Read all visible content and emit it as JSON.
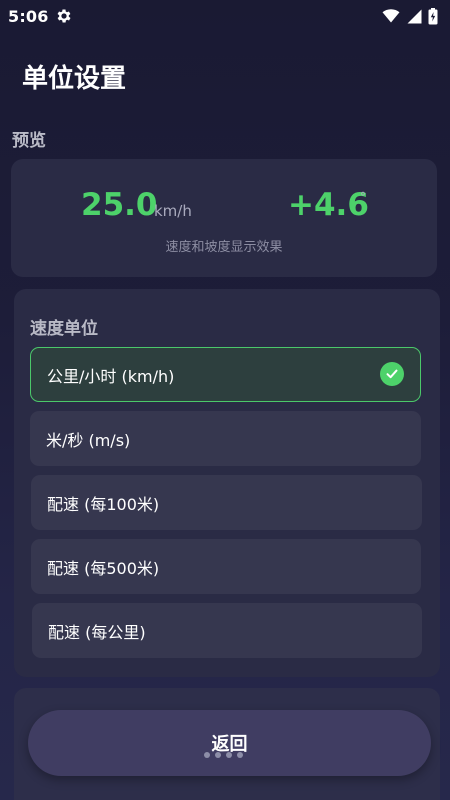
{
  "status_bar": {
    "time": "5:06"
  },
  "page": {
    "title": "单位设置"
  },
  "preview": {
    "label": "预览",
    "speed_value": "25.0",
    "speed_unit": "km/h",
    "slope_value": "+4.6",
    "slope_unit": "°",
    "caption": "速度和坡度显示效果"
  },
  "speed_units": {
    "title": "速度单位",
    "options": [
      {
        "label": "公里/小时 (km/h)",
        "selected": true
      },
      {
        "label": "米/秒 (m/s)",
        "selected": false
      },
      {
        "label": "配速 (每100米)",
        "selected": false
      },
      {
        "label": "配速 (每500米)",
        "selected": false
      },
      {
        "label": "配速 (每公里)",
        "selected": false
      }
    ]
  },
  "footer": {
    "back_label": "返回"
  },
  "colors": {
    "accent": "#4dd26a",
    "background": "#1a1a33",
    "card": "#2a2b45",
    "option": "#36374f",
    "button": "#403d62"
  }
}
